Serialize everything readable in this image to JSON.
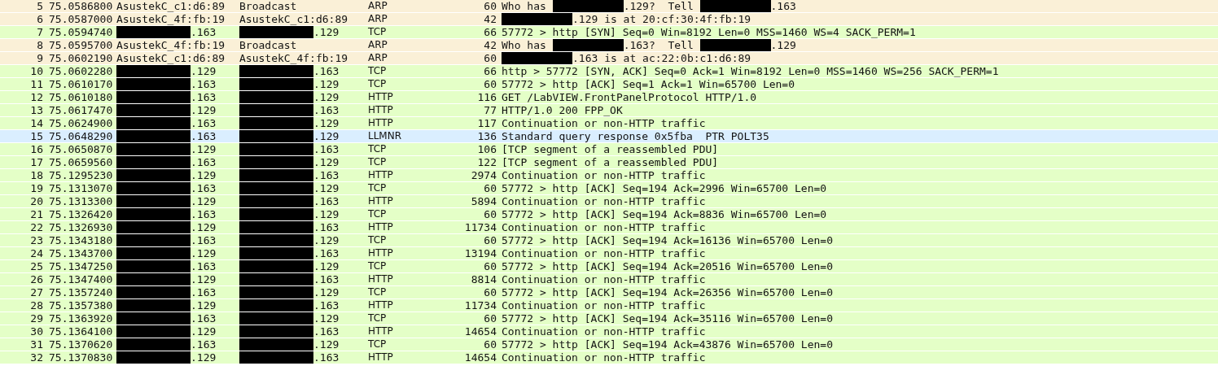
{
  "packets": [
    {
      "no": "5",
      "time": "75.0586800",
      "source": {
        "redacted": false,
        "text": "AsustekC_c1:d6:89"
      },
      "destination": {
        "redacted": false,
        "text": "Broadcast"
      },
      "protocol": "ARP",
      "length": "60",
      "info": [
        {
          "kind": "text",
          "text": "Who has "
        },
        {
          "kind": "redacted"
        },
        {
          "kind": "text",
          "text": ".129?  Tell "
        },
        {
          "kind": "redacted"
        },
        {
          "kind": "text",
          "text": ".163"
        }
      ],
      "color": "#faf0d7"
    },
    {
      "no": "6",
      "time": "75.0587000",
      "source": {
        "redacted": false,
        "text": "AsustekC_4f:fb:19"
      },
      "destination": {
        "redacted": false,
        "text": "AsustekC_c1:d6:89"
      },
      "protocol": "ARP",
      "length": "42",
      "info": [
        {
          "kind": "redacted"
        },
        {
          "kind": "text",
          "text": ".129 is at 20:cf:30:4f:fb:19"
        }
      ],
      "color": "#faf0d7"
    },
    {
      "no": "7",
      "time": "75.0594740",
      "source": {
        "redacted": true,
        "text": ".163"
      },
      "destination": {
        "redacted": true,
        "text": ".129"
      },
      "protocol": "TCP",
      "length": "66",
      "info": [
        {
          "kind": "text",
          "text": "57772 > http [SYN] Seq=0 Win=8192 Len=0 MSS=1460 WS=4 SACK_PERM=1"
        }
      ],
      "color": "#e4ffc7"
    },
    {
      "no": "8",
      "time": "75.0595700",
      "source": {
        "redacted": false,
        "text": "AsustekC_4f:fb:19"
      },
      "destination": {
        "redacted": false,
        "text": "Broadcast"
      },
      "protocol": "ARP",
      "length": "42",
      "info": [
        {
          "kind": "text",
          "text": "Who has "
        },
        {
          "kind": "redacted"
        },
        {
          "kind": "text",
          "text": ".163?  Tell "
        },
        {
          "kind": "redacted"
        },
        {
          "kind": "text",
          "text": ".129"
        }
      ],
      "color": "#faf0d7"
    },
    {
      "no": "9",
      "time": "75.0602190",
      "source": {
        "redacted": false,
        "text": "AsustekC_c1:d6:89"
      },
      "destination": {
        "redacted": false,
        "text": "AsustekC_4f:fb:19"
      },
      "protocol": "ARP",
      "length": "60",
      "info": [
        {
          "kind": "redacted"
        },
        {
          "kind": "text",
          "text": ".163 is at ac:22:0b:c1:d6:89"
        }
      ],
      "color": "#faf0d7"
    },
    {
      "no": "10",
      "time": "75.0602280",
      "source": {
        "redacted": true,
        "text": ".129"
      },
      "destination": {
        "redacted": true,
        "text": ".163"
      },
      "protocol": "TCP",
      "length": "66",
      "info": [
        {
          "kind": "text",
          "text": "http > 57772 [SYN, ACK] Seq=0 Ack=1 Win=8192 Len=0 MSS=1460 WS=256 SACK_PERM=1"
        }
      ],
      "color": "#e4ffc7"
    },
    {
      "no": "11",
      "time": "75.0610170",
      "source": {
        "redacted": true,
        "text": ".163"
      },
      "destination": {
        "redacted": true,
        "text": ".129"
      },
      "protocol": "TCP",
      "length": "60",
      "info": [
        {
          "kind": "text",
          "text": "57772 > http [ACK] Seq=1 Ack=1 Win=65700 Len=0"
        }
      ],
      "color": "#e4ffc7"
    },
    {
      "no": "12",
      "time": "75.0610180",
      "source": {
        "redacted": true,
        "text": ".163"
      },
      "destination": {
        "redacted": true,
        "text": ".129"
      },
      "protocol": "HTTP",
      "length": "116",
      "info": [
        {
          "kind": "text",
          "text": "GET /LabVIEW.FrontPanelProtocol HTTP/1.0"
        }
      ],
      "color": "#e4ffc7"
    },
    {
      "no": "13",
      "time": "75.0617470",
      "source": {
        "redacted": true,
        "text": ".129"
      },
      "destination": {
        "redacted": true,
        "text": ".163"
      },
      "protocol": "HTTP",
      "length": "77",
      "info": [
        {
          "kind": "text",
          "text": "HTTP/1.0 200 FPP_OK"
        }
      ],
      "color": "#e4ffc7"
    },
    {
      "no": "14",
      "time": "75.0624900",
      "source": {
        "redacted": true,
        "text": ".163"
      },
      "destination": {
        "redacted": true,
        "text": ".129"
      },
      "protocol": "HTTP",
      "length": "117",
      "info": [
        {
          "kind": "text",
          "text": "Continuation or non-HTTP traffic"
        }
      ],
      "color": "#e4ffc7"
    },
    {
      "no": "15",
      "time": "75.0648290",
      "source": {
        "redacted": true,
        "text": ".163"
      },
      "destination": {
        "redacted": true,
        "text": ".129"
      },
      "protocol": "LLMNR",
      "length": "136",
      "info": [
        {
          "kind": "text",
          "text": "Standard query response 0x5fba  PTR POLT35"
        }
      ],
      "color": "#daeeff"
    },
    {
      "no": "16",
      "time": "75.0650870",
      "source": {
        "redacted": true,
        "text": ".129"
      },
      "destination": {
        "redacted": true,
        "text": ".163"
      },
      "protocol": "TCP",
      "length": "106",
      "info": [
        {
          "kind": "text",
          "text": "[TCP segment of a reassembled PDU]"
        }
      ],
      "color": "#e4ffc7"
    },
    {
      "no": "17",
      "time": "75.0659560",
      "source": {
        "redacted": true,
        "text": ".163"
      },
      "destination": {
        "redacted": true,
        "text": ".129"
      },
      "protocol": "TCP",
      "length": "122",
      "info": [
        {
          "kind": "text",
          "text": "[TCP segment of a reassembled PDU]"
        }
      ],
      "color": "#e4ffc7"
    },
    {
      "no": "18",
      "time": "75.1295230",
      "source": {
        "redacted": true,
        "text": ".129"
      },
      "destination": {
        "redacted": true,
        "text": ".163"
      },
      "protocol": "HTTP",
      "length": "2974",
      "info": [
        {
          "kind": "text",
          "text": "Continuation or non-HTTP traffic"
        }
      ],
      "color": "#e4ffc7"
    },
    {
      "no": "19",
      "time": "75.1313070",
      "source": {
        "redacted": true,
        "text": ".163"
      },
      "destination": {
        "redacted": true,
        "text": ".129"
      },
      "protocol": "TCP",
      "length": "60",
      "info": [
        {
          "kind": "text",
          "text": "57772 > http [ACK] Seq=194 Ack=2996 Win=65700 Len=0"
        }
      ],
      "color": "#e4ffc7"
    },
    {
      "no": "20",
      "time": "75.1313300",
      "source": {
        "redacted": true,
        "text": ".129"
      },
      "destination": {
        "redacted": true,
        "text": ".163"
      },
      "protocol": "HTTP",
      "length": "5894",
      "info": [
        {
          "kind": "text",
          "text": "Continuation or non-HTTP traffic"
        }
      ],
      "color": "#e4ffc7"
    },
    {
      "no": "21",
      "time": "75.1326420",
      "source": {
        "redacted": true,
        "text": ".163"
      },
      "destination": {
        "redacted": true,
        "text": ".129"
      },
      "protocol": "TCP",
      "length": "60",
      "info": [
        {
          "kind": "text",
          "text": "57772 > http [ACK] Seq=194 Ack=8836 Win=65700 Len=0"
        }
      ],
      "color": "#e4ffc7"
    },
    {
      "no": "22",
      "time": "75.1326930",
      "source": {
        "redacted": true,
        "text": ".129"
      },
      "destination": {
        "redacted": true,
        "text": ".163"
      },
      "protocol": "HTTP",
      "length": "11734",
      "info": [
        {
          "kind": "text",
          "text": "Continuation or non-HTTP traffic"
        }
      ],
      "color": "#e4ffc7"
    },
    {
      "no": "23",
      "time": "75.1343180",
      "source": {
        "redacted": true,
        "text": ".163"
      },
      "destination": {
        "redacted": true,
        "text": ".129"
      },
      "protocol": "TCP",
      "length": "60",
      "info": [
        {
          "kind": "text",
          "text": "57772 > http [ACK] Seq=194 Ack=16136 Win=65700 Len=0"
        }
      ],
      "color": "#e4ffc7"
    },
    {
      "no": "24",
      "time": "75.1343700",
      "source": {
        "redacted": true,
        "text": ".129"
      },
      "destination": {
        "redacted": true,
        "text": ".163"
      },
      "protocol": "HTTP",
      "length": "13194",
      "info": [
        {
          "kind": "text",
          "text": "Continuation or non-HTTP traffic"
        }
      ],
      "color": "#e4ffc7"
    },
    {
      "no": "25",
      "time": "75.1347250",
      "source": {
        "redacted": true,
        "text": ".163"
      },
      "destination": {
        "redacted": true,
        "text": ".129"
      },
      "protocol": "TCP",
      "length": "60",
      "info": [
        {
          "kind": "text",
          "text": "57772 > http [ACK] Seq=194 Ack=20516 Win=65700 Len=0"
        }
      ],
      "color": "#e4ffc7"
    },
    {
      "no": "26",
      "time": "75.1347400",
      "source": {
        "redacted": true,
        "text": ".129"
      },
      "destination": {
        "redacted": true,
        "text": ".163"
      },
      "protocol": "HTTP",
      "length": "8814",
      "info": [
        {
          "kind": "text",
          "text": "Continuation or non-HTTP traffic"
        }
      ],
      "color": "#e4ffc7"
    },
    {
      "no": "27",
      "time": "75.1357240",
      "source": {
        "redacted": true,
        "text": ".163"
      },
      "destination": {
        "redacted": true,
        "text": ".129"
      },
      "protocol": "TCP",
      "length": "60",
      "info": [
        {
          "kind": "text",
          "text": "57772 > http [ACK] Seq=194 Ack=26356 Win=65700 Len=0"
        }
      ],
      "color": "#e4ffc7"
    },
    {
      "no": "28",
      "time": "75.1357380",
      "source": {
        "redacted": true,
        "text": ".129"
      },
      "destination": {
        "redacted": true,
        "text": ".163"
      },
      "protocol": "HTTP",
      "length": "11734",
      "info": [
        {
          "kind": "text",
          "text": "Continuation or non-HTTP traffic"
        }
      ],
      "color": "#e4ffc7"
    },
    {
      "no": "29",
      "time": "75.1363920",
      "source": {
        "redacted": true,
        "text": ".163"
      },
      "destination": {
        "redacted": true,
        "text": ".129"
      },
      "protocol": "TCP",
      "length": "60",
      "info": [
        {
          "kind": "text",
          "text": "57772 > http [ACK] Seq=194 Ack=35116 Win=65700 Len=0"
        }
      ],
      "color": "#e4ffc7"
    },
    {
      "no": "30",
      "time": "75.1364100",
      "source": {
        "redacted": true,
        "text": ".129"
      },
      "destination": {
        "redacted": true,
        "text": ".163"
      },
      "protocol": "HTTP",
      "length": "14654",
      "info": [
        {
          "kind": "text",
          "text": "Continuation or non-HTTP traffic"
        }
      ],
      "color": "#e4ffc7"
    },
    {
      "no": "31",
      "time": "75.1370620",
      "source": {
        "redacted": true,
        "text": ".163"
      },
      "destination": {
        "redacted": true,
        "text": ".129"
      },
      "protocol": "TCP",
      "length": "60",
      "info": [
        {
          "kind": "text",
          "text": "57772 > http [ACK] Seq=194 Ack=43876 Win=65700 Len=0"
        }
      ],
      "color": "#e4ffc7"
    },
    {
      "no": "32",
      "time": "75.1370830",
      "source": {
        "redacted": true,
        "text": ".129"
      },
      "destination": {
        "redacted": true,
        "text": ".163"
      },
      "protocol": "HTTP",
      "length": "14654",
      "info": [
        {
          "kind": "text",
          "text": "Continuation or non-HTTP traffic"
        }
      ],
      "color": "#e4ffc7"
    }
  ]
}
